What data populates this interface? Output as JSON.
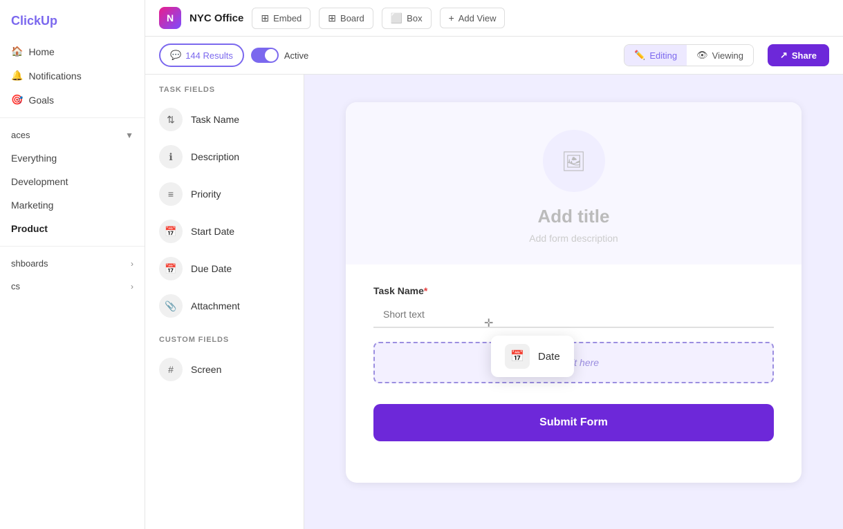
{
  "sidebar": {
    "logo": "ClickUp",
    "nav_items": [
      {
        "id": "home",
        "label": "Home"
      },
      {
        "id": "notifications",
        "label": "Notifications"
      },
      {
        "id": "goals",
        "label": "Goals"
      }
    ],
    "spaces_section": "aces",
    "space_items": [
      {
        "id": "everything",
        "label": "Everything"
      },
      {
        "id": "development",
        "label": "Development"
      },
      {
        "id": "marketing",
        "label": "Marketing"
      },
      {
        "id": "product",
        "label": "Product",
        "active": true
      }
    ],
    "dashboards_label": "shboards",
    "docs_label": "cs"
  },
  "top_nav": {
    "workspace_initial": "N",
    "workspace_name": "NYC Office",
    "embed_btn": "Embed",
    "board_btn": "Board",
    "box_btn": "Box",
    "add_view_btn": "Add View"
  },
  "toolbar": {
    "results_count": "144 Results",
    "active_toggle_label": "Active",
    "editing_label": "Editing",
    "viewing_label": "Viewing",
    "share_label": "Share"
  },
  "fields_panel": {
    "task_fields_title": "TASK FIELDS",
    "task_fields": [
      {
        "id": "task-name",
        "label": "Task Name",
        "icon": "⇅"
      },
      {
        "id": "description",
        "label": "Description",
        "icon": "ℹ"
      },
      {
        "id": "priority",
        "label": "Priority",
        "icon": "≡"
      },
      {
        "id": "start-date",
        "label": "Start Date",
        "icon": "📅"
      },
      {
        "id": "due-date",
        "label": "Due Date",
        "icon": "📅"
      },
      {
        "id": "attachment",
        "label": "Attachment",
        "icon": "📎"
      }
    ],
    "custom_fields_title": "CUSTOM FIELDS",
    "custom_fields": [
      {
        "id": "screen",
        "label": "Screen",
        "icon": "#"
      }
    ]
  },
  "form": {
    "cover_icon": "🖼",
    "title_placeholder": "Add title",
    "desc_placeholder": "Add form description",
    "task_name_label": "Task Name",
    "task_name_required": "*",
    "task_name_placeholder": "Short text",
    "drop_zone_text": "Drop it here",
    "submit_label": "Submit Form"
  },
  "drag_tooltip": {
    "icon": "📅",
    "label": "Date"
  },
  "colors": {
    "accent": "#6d28d9",
    "accent_light": "#ede9ff",
    "bg": "#f0eeff"
  }
}
